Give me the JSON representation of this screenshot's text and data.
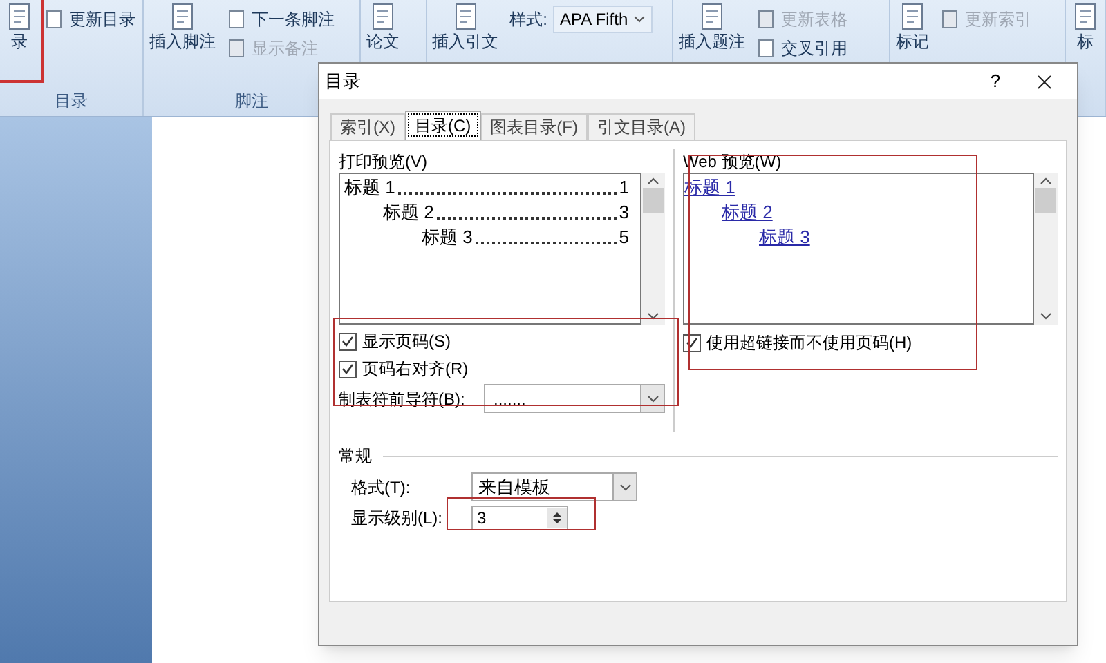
{
  "ribbon": {
    "groups": [
      {
        "label": "目录",
        "items": [
          {
            "kind": "large",
            "text": "录"
          },
          {
            "kind": "small",
            "text": "更新目录",
            "disabled": false
          }
        ]
      },
      {
        "label": "脚注",
        "items": [
          {
            "kind": "large",
            "text": "插入脚注"
          },
          {
            "kind": "small",
            "text": "下一条脚注",
            "disabled": false
          },
          {
            "kind": "small",
            "text": "显示备注",
            "disabled": true
          }
        ]
      },
      {
        "items": [
          {
            "kind": "large",
            "text": "论文"
          }
        ]
      },
      {
        "items": [
          {
            "kind": "large",
            "text": "插入引文"
          },
          {
            "kind": "combo",
            "text": "样式:",
            "value": "APA Fifth"
          }
        ]
      },
      {
        "items": [
          {
            "kind": "large",
            "text": "插入题注"
          },
          {
            "kind": "small",
            "text": "更新表格",
            "disabled": true
          },
          {
            "kind": "small",
            "text": "交叉引用",
            "disabled": false
          }
        ]
      },
      {
        "items": [
          {
            "kind": "large",
            "text": "标记"
          },
          {
            "kind": "small",
            "text": "更新索引",
            "disabled": true
          }
        ]
      },
      {
        "items": [
          {
            "kind": "large",
            "text": "标"
          }
        ]
      }
    ]
  },
  "dialog": {
    "title": "目录",
    "help": "?",
    "tabs": [
      {
        "label": "索引(X)",
        "selected": false
      },
      {
        "label": "目录(C)",
        "selected": true
      },
      {
        "label": "图表目录(F)",
        "selected": false
      },
      {
        "label": "引文目录(A)",
        "selected": false
      }
    ],
    "print_preview": {
      "label": "打印预览(V)",
      "entries": [
        {
          "text": "标题 1",
          "page": "1",
          "children": [
            {
              "text": "标题 2",
              "page": "3",
              "children": [
                {
                  "text": "标题 3",
                  "page": "5"
                }
              ]
            }
          ]
        }
      ]
    },
    "options": [
      {
        "label": "显示页码(S)",
        "checked": true
      },
      {
        "label": "页码右对齐(R)",
        "checked": true
      }
    ],
    "leader": {
      "label": "制表符前导符(B):",
      "value": "......."
    },
    "web_preview": {
      "label": "Web 预览(W)",
      "entries": [
        {
          "text": "标题 1",
          "children": [
            {
              "text": "标题 2",
              "children": [
                {
                  "text": "标题 3"
                }
              ]
            }
          ]
        }
      ]
    },
    "web_option": {
      "label": "使用超链接而不使用页码(H)",
      "checked": true
    },
    "general": {
      "title": "常规",
      "format": {
        "label": "格式(T):",
        "value": "来自模板"
      },
      "levels": {
        "label": "显示级别(L):",
        "value": "3"
      }
    }
  }
}
